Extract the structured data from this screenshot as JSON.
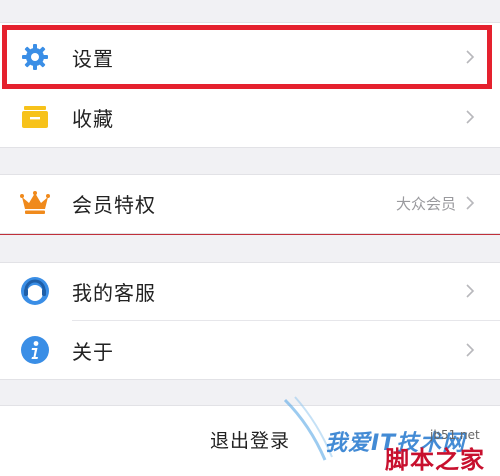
{
  "settings_group": {
    "settings_label": "设置",
    "favorites_label": "收藏"
  },
  "vip_group": {
    "vip_label": "会员特权",
    "vip_level": "大众会员"
  },
  "support_group": {
    "service_label": "我的客服",
    "about_label": "关于"
  },
  "logout": {
    "label": "退出登录"
  },
  "watermark": {
    "brand": "我爱IT技术网",
    "site": "脚本之家",
    "domain": "jb51.net"
  },
  "colors": {
    "background": "#f1f1f4",
    "icon_blue": "#3a8ee6",
    "favorites_yellow": "#f7c21a",
    "crown_orange": "#f08a1c",
    "highlight_red": "#e5212e"
  },
  "icons": {
    "settings": "gear-icon",
    "favorites": "folder-icon",
    "vip": "crown-icon",
    "service": "headset-icon",
    "about": "info-icon",
    "chevron": "chevron-right-icon"
  }
}
